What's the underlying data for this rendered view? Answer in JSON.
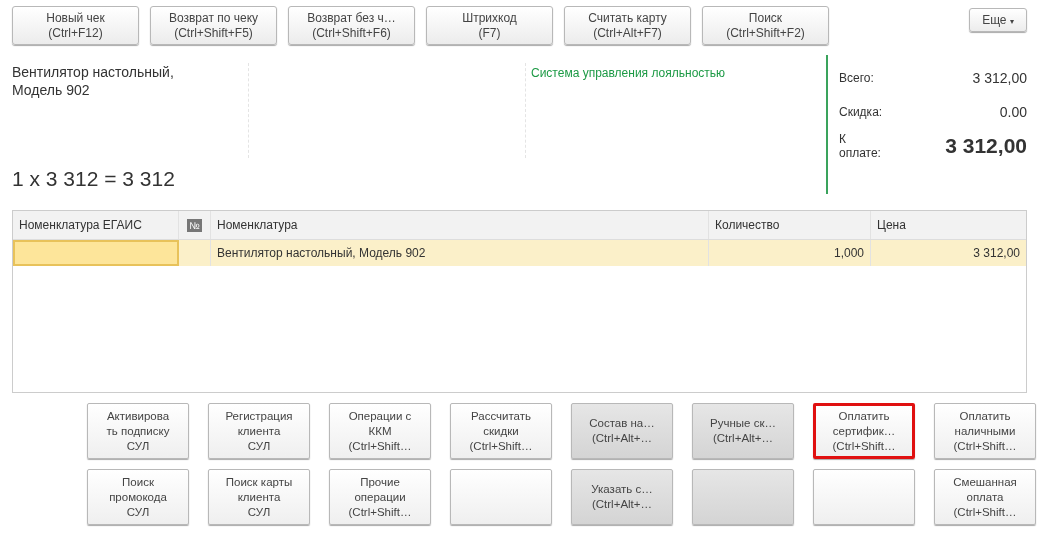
{
  "toolbar": {
    "buttons": [
      {
        "lines": [
          "Новый чек",
          "(Ctrl+F12)"
        ]
      },
      {
        "lines": [
          "Возврат по чеку",
          "(Ctrl+Shift+F5)"
        ]
      },
      {
        "lines": [
          "Возврат без ч…",
          "(Ctrl+Shift+F6)"
        ]
      },
      {
        "lines": [
          "Штрихкод",
          "(F7)"
        ]
      },
      {
        "lines": [
          "Считать карту",
          "(Ctrl+Alt+F7)"
        ]
      },
      {
        "lines": [
          "Поиск",
          "(Ctrl+Shift+F2)"
        ]
      }
    ],
    "more": {
      "label": "Еще",
      "caret": "▾"
    }
  },
  "item_info": {
    "name": "Вентилятор настольный, Модель 902",
    "calc": "1 x 3 312 = 3 312"
  },
  "loyalty_link": "Система управления лояльностью",
  "totals": [
    {
      "label": "Всего:",
      "value": "3 312,00",
      "kind": "normal"
    },
    {
      "label": "Скидка:",
      "value": "0.00",
      "kind": "normal"
    },
    {
      "label": "К оплате:",
      "value": "3 312,00",
      "kind": "big"
    }
  ],
  "table": {
    "columns": [
      {
        "label": "Номенклатура ЕГАИС",
        "kind": "text"
      },
      {
        "label": "№",
        "kind": "icon"
      },
      {
        "label": "Номенклатура",
        "kind": "text"
      },
      {
        "label": "Количество",
        "kind": "text"
      },
      {
        "label": "Цена",
        "kind": "text"
      }
    ],
    "rows": [
      {
        "selected": true,
        "cells": [
          "",
          "",
          "Вентилятор настольный, Модель 902",
          "1,000",
          "3 312,00"
        ]
      }
    ]
  },
  "action_buttons": [
    {
      "lines": [
        "Активирова",
        "ть подписку",
        "СУЛ"
      ],
      "shaded": false,
      "highlighted": false
    },
    {
      "lines": [
        "Регистрация",
        "клиента",
        "СУЛ"
      ],
      "shaded": false,
      "highlighted": false
    },
    {
      "lines": [
        "Операции с",
        "ККМ",
        "(Ctrl+Shift…"
      ],
      "shaded": false,
      "highlighted": false
    },
    {
      "lines": [
        "Рассчитать",
        "скидки",
        "(Ctrl+Shift…"
      ],
      "shaded": false,
      "highlighted": false
    },
    {
      "lines": [
        "Состав на…",
        "(Ctrl+Alt+…"
      ],
      "shaded": true,
      "highlighted": false
    },
    {
      "lines": [
        "Ручные ск…",
        "(Ctrl+Alt+…"
      ],
      "shaded": true,
      "highlighted": false
    },
    {
      "lines": [
        "Оплатить",
        "сертифик…",
        "(Ctrl+Shift…"
      ],
      "shaded": false,
      "highlighted": true
    },
    {
      "lines": [
        "Оплатить",
        "наличными",
        "(Ctrl+Shift…"
      ],
      "shaded": false,
      "highlighted": false
    },
    {
      "lines": [
        "Поиск",
        "промокода",
        "СУЛ"
      ],
      "shaded": false,
      "highlighted": false
    },
    {
      "lines": [
        "Поиск карты",
        "клиента",
        "СУЛ"
      ],
      "shaded": false,
      "highlighted": false
    },
    {
      "lines": [
        "Прочие",
        "операции",
        "(Ctrl+Shift…"
      ],
      "shaded": false,
      "highlighted": false
    },
    {
      "shaded": false,
      "highlighted": false
    },
    {
      "lines": [
        "Указать с…",
        "(Ctrl+Alt+…"
      ],
      "shaded": true,
      "highlighted": false
    },
    {
      "shaded": true,
      "highlighted": false
    },
    {
      "shaded": false,
      "highlighted": false
    },
    {
      "lines": [
        "Смешанная",
        "оплата",
        "(Ctrl+Shift…"
      ],
      "shaded": false,
      "highlighted": false
    }
  ]
}
